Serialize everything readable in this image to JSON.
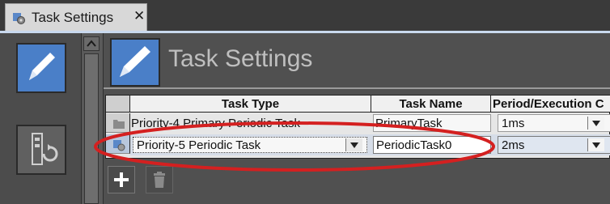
{
  "tab": {
    "title": "Task Settings",
    "close": "✕"
  },
  "header": {
    "title": "Task Settings"
  },
  "table": {
    "columns": [
      "Task Type",
      "Task Name",
      "Period/Execution C"
    ],
    "rows": [
      {
        "task_type": "Priority-4 Primary Periodic Task",
        "task_name": "PrimaryTask",
        "period": "1ms"
      },
      {
        "task_type": "Priority-5 Periodic Task",
        "task_name": "PeriodicTask0",
        "period": "2ms"
      }
    ]
  },
  "colors": {
    "accent": "#4a7fc8",
    "highlight": "#d42020"
  }
}
